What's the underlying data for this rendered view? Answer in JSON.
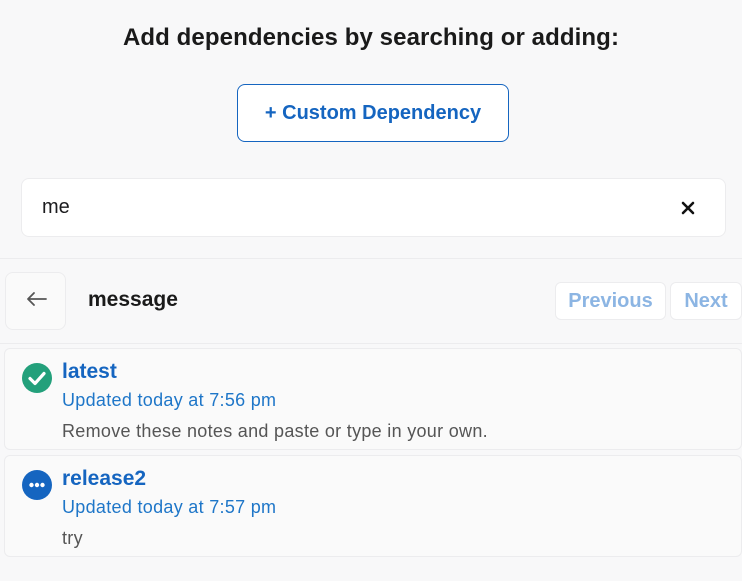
{
  "heading": "Add dependencies by searching or adding:",
  "custom_button_label": "+ Custom Dependency",
  "search": {
    "value": "me",
    "clear_icon": "close-icon"
  },
  "detail": {
    "back_icon": "arrow-left-icon",
    "package_name": "message",
    "previous_label": "Previous",
    "next_label": "Next"
  },
  "versions": [
    {
      "title": "latest",
      "updated": "Updated today at 7:56 pm",
      "notes": "Remove these notes and paste or type in your own.",
      "status_icon": "check-circle-icon",
      "status_color": "#23a07b"
    },
    {
      "title": "release2",
      "updated": "Updated today at 7:57 pm",
      "notes": "try",
      "status_icon": "more-horizontal-circle-icon",
      "status_color": "#1565c0"
    }
  ],
  "colors": {
    "accent": "#1565c0",
    "nav_disabled": "#8cb5e3",
    "success": "#23a07b"
  }
}
